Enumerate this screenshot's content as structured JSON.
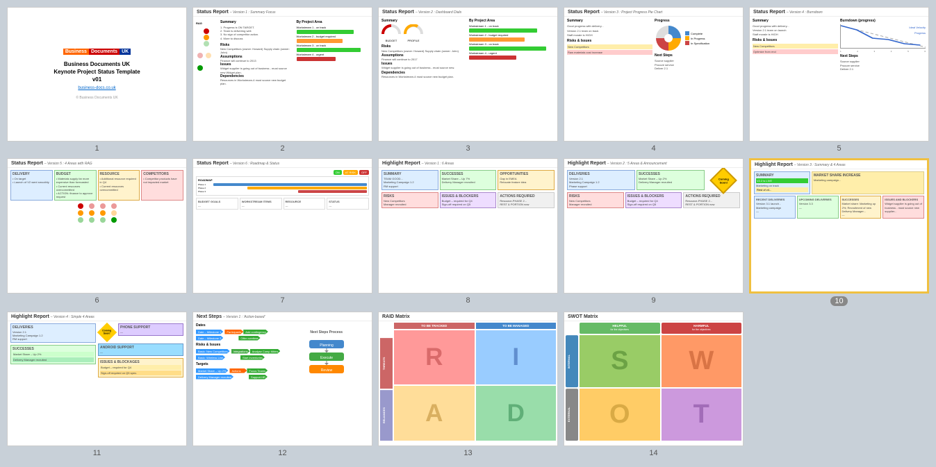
{
  "slides": [
    {
      "id": 1,
      "type": "title",
      "number": "1",
      "active": false,
      "logo": {
        "business": "Business",
        "documents": "Documents",
        "uk": "UK"
      },
      "title": "Business Documents UK\nKeynote Project Status Template\nv01",
      "link": "business-docs.co.uk",
      "footer": "© Business Documents UK"
    },
    {
      "id": 2,
      "type": "status-report-v1",
      "number": "2",
      "active": false,
      "header": "Status Report",
      "version": "– Version 1 : Summary Focus"
    },
    {
      "id": 3,
      "type": "status-report-v2",
      "number": "3",
      "active": false,
      "header": "Status Report",
      "version": "– Version 2 : Dashboard Dials"
    },
    {
      "id": 4,
      "type": "status-report-v3",
      "number": "4",
      "active": false,
      "header": "Status Report",
      "version": "– Version 3 : Project Progress Pie Chart"
    },
    {
      "id": 5,
      "type": "status-report-v4",
      "number": "5",
      "active": false,
      "header": "Status Report",
      "version": "– Version 4 : Burndown"
    },
    {
      "id": 6,
      "type": "status-report-v5",
      "number": "6",
      "active": false,
      "header": "Status Report",
      "version": "– Version 5 : 4 Areas with RAG"
    },
    {
      "id": 7,
      "type": "status-report-v6",
      "number": "7",
      "active": false,
      "header": "Status Report",
      "version": "– Version 6 : Roadmap & Status"
    },
    {
      "id": 8,
      "type": "highlight-report-v1",
      "number": "8",
      "active": false,
      "header": "Highlight Report",
      "version": "– Version 1 : 6 Areas"
    },
    {
      "id": 9,
      "type": "highlight-report-v2",
      "number": "9",
      "active": false,
      "header": "Highlight Report",
      "version": "– Version 2 : 5 Areas & Announcement"
    },
    {
      "id": 10,
      "type": "highlight-report-v3",
      "number": "10",
      "active": true,
      "header": "Highlight Report",
      "version": "– Version 3 : Summary & 4 Areas"
    },
    {
      "id": 11,
      "type": "highlight-report-v4",
      "number": "11",
      "active": false,
      "header": "Highlight Report",
      "version": "– Version 4 : Simple 4 Areas"
    },
    {
      "id": 12,
      "type": "next-steps-v1",
      "number": "12",
      "active": false,
      "header": "Next Steps",
      "version": "– Version 1 : 'Action-based'"
    },
    {
      "id": 13,
      "type": "raid-matrix",
      "number": "13",
      "active": false,
      "header": "RAID Matrix",
      "version": ""
    },
    {
      "id": 14,
      "type": "swot-matrix",
      "number": "14",
      "active": false,
      "header": "SWOT Matrix",
      "version": ""
    }
  ]
}
